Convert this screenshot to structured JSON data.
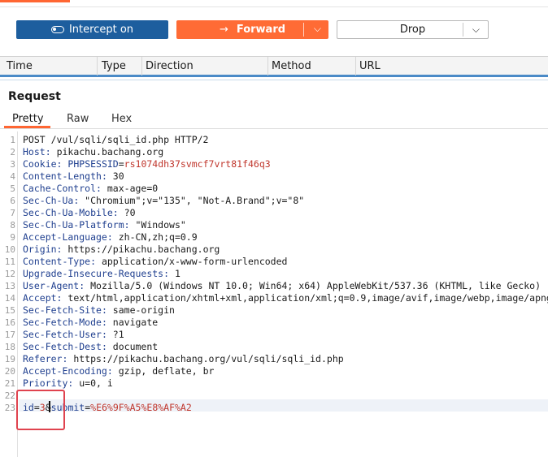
{
  "toolbar": {
    "intercept_label": "Intercept on",
    "forward_label": "Forward",
    "drop_label": "Drop"
  },
  "history_columns": [
    "Time",
    "Type",
    "Direction",
    "Method",
    "URL"
  ],
  "request": {
    "title": "Request",
    "tabs": [
      "Pretty",
      "Raw",
      "Hex"
    ],
    "active_tab": "Pretty",
    "lines": [
      {
        "num": "1",
        "text": "POST /vul/sqli/sqli_id.php HTTP/2"
      },
      {
        "num": "2",
        "name": "Host",
        "value": " pikachu.bachang.org"
      },
      {
        "num": "3",
        "name": "Cookie",
        "value": " ",
        "cookie_name": "PHPSESSID",
        "cookie_eq": "=",
        "cookie_value": "rs1074dh37svmcf7vrt81f46q3"
      },
      {
        "num": "4",
        "name": "Content-Length",
        "value": " 30"
      },
      {
        "num": "5",
        "name": "Cache-Control",
        "value": " max-age=0"
      },
      {
        "num": "6",
        "name": "Sec-Ch-Ua",
        "value": " \"Chromium\";v=\"135\", \"Not-A.Brand\";v=\"8\""
      },
      {
        "num": "7",
        "name": "Sec-Ch-Ua-Mobile",
        "value": " ?0"
      },
      {
        "num": "8",
        "name": "Sec-Ch-Ua-Platform",
        "value": " \"Windows\""
      },
      {
        "num": "9",
        "name": "Accept-Language",
        "value": " zh-CN,zh;q=0.9"
      },
      {
        "num": "10",
        "name": "Origin",
        "value": " https://pikachu.bachang.org"
      },
      {
        "num": "11",
        "name": "Content-Type",
        "value": " application/x-www-form-urlencoded"
      },
      {
        "num": "12",
        "name": "Upgrade-Insecure-Requests",
        "value": " 1"
      },
      {
        "num": "13",
        "name": "User-Agent",
        "value": " Mozilla/5.0 (Windows NT 10.0; Win64; x64) AppleWebKit/537.36 (KHTML, like Gecko)"
      },
      {
        "num": "14",
        "name": "Accept",
        "value": " text/html,application/xhtml+xml,application/xml;q=0.9,image/avif,image/webp,image/apng"
      },
      {
        "num": "15",
        "name": "Sec-Fetch-Site",
        "value": " same-origin"
      },
      {
        "num": "16",
        "name": "Sec-Fetch-Mode",
        "value": " navigate"
      },
      {
        "num": "17",
        "name": "Sec-Fetch-User",
        "value": " ?1"
      },
      {
        "num": "18",
        "name": "Sec-Fetch-Dest",
        "value": " document"
      },
      {
        "num": "19",
        "name": "Referer",
        "value": " https://pikachu.bachang.org/vul/sqli/sqli_id.php"
      },
      {
        "num": "20",
        "name": "Accept-Encoding",
        "value": " gzip, deflate, br"
      },
      {
        "num": "21",
        "name": "Priority",
        "value": " u=0, i"
      },
      {
        "num": "22",
        "text": ""
      },
      {
        "num": "23",
        "body": [
          {
            "k": "id",
            "eq": "=",
            "v": "3"
          },
          {
            "amp": "&"
          },
          {
            "k": "submit",
            "eq": "=",
            "v": "%E6%9F%A5%E8%AF%A2"
          }
        ]
      }
    ]
  },
  "colors": {
    "accent": "#ff6633",
    "intercept_bg": "#1d5e9e",
    "forward_bg": "#ff6b35",
    "header_name": "#1f3f8f",
    "cookie_value": "#c0362c",
    "annotation_box": "#e0434f"
  }
}
